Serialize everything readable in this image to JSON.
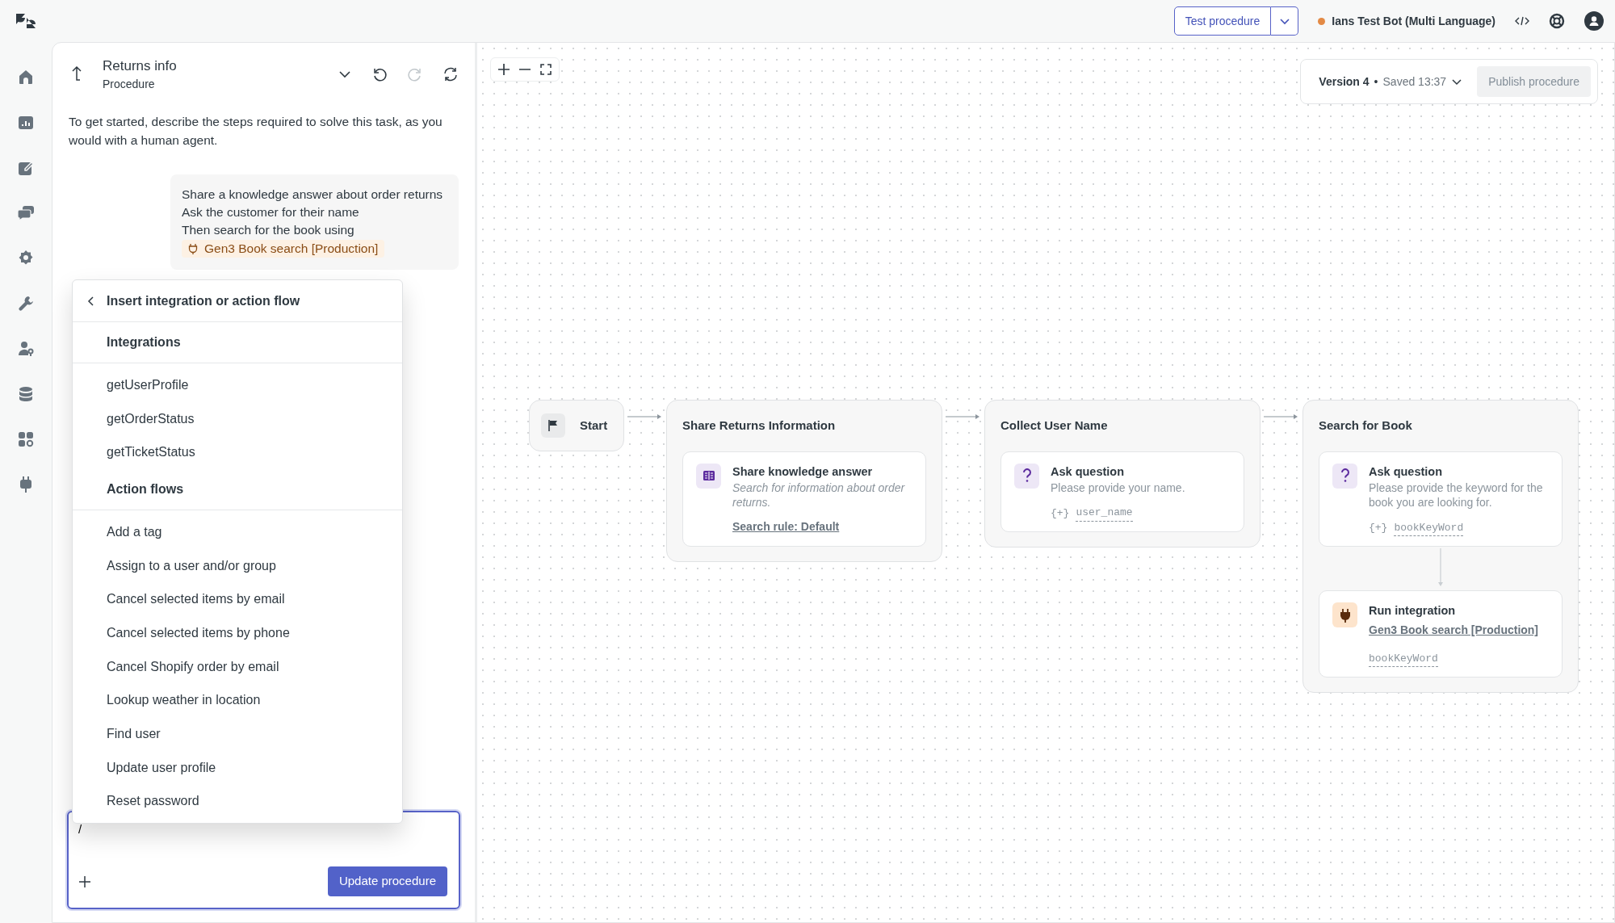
{
  "topbar": {
    "test_button": "Test procedure",
    "bot_name": "Ians Test Bot (Multi Language)"
  },
  "procedure": {
    "title": "Returns info",
    "subtitle": "Procedure",
    "undo": {
      "disabled": false
    },
    "redo": {
      "disabled": true
    }
  },
  "intro": "To get started, describe the steps required to solve this task, as you would with a human agent.",
  "message": {
    "lines": [
      "Share a knowledge answer about order returns",
      "Ask the customer for their name",
      "Then search for the book using"
    ],
    "integration_chip": "Gen3 Book search [Production]"
  },
  "menu": {
    "title": "Insert integration or action flow",
    "sections": [
      {
        "heading": "Integrations",
        "items": [
          "getUserProfile",
          "getOrderStatus",
          "getTicketStatus"
        ]
      },
      {
        "heading": "Action flows",
        "items": [
          "Add a tag",
          "Assign to a user and/or group",
          "Cancel selected items by email",
          "Cancel selected items by phone",
          "Cancel Shopify order by email",
          "Lookup weather in location",
          "Find user",
          "Update user profile",
          "Reset password"
        ]
      }
    ]
  },
  "composer": {
    "value": "/",
    "button": "Update procedure"
  },
  "version": {
    "label": "Version 4",
    "separator": "•",
    "saved": "Saved 13:37",
    "publish": "Publish procedure",
    "publish_disabled": true
  },
  "flow": {
    "nodes": [
      {
        "kind": "start",
        "label": "Start"
      },
      {
        "kind": "step",
        "title": "Share Returns Information",
        "actions": [
          {
            "kind": "knowledge",
            "title": "Share knowledge answer",
            "description": "Search for information about order returns.",
            "link": "Search rule: Default"
          }
        ]
      },
      {
        "kind": "step",
        "title": "Collect User Name",
        "actions": [
          {
            "kind": "question",
            "title": "Ask question",
            "description": "Please provide your name.",
            "variable_prefix": "{+}",
            "variable": "user_name"
          }
        ]
      },
      {
        "kind": "step",
        "title": "Search for Book",
        "actions": [
          {
            "kind": "question",
            "title": "Ask question",
            "description": "Please provide the keyword for the book you are looking for.",
            "variable_prefix": "{+}",
            "variable": "bookKeyWord"
          },
          {
            "kind": "integration",
            "title": "Run integration",
            "link": "Gen3 Book search [Production]",
            "variable": "bookKeyWord"
          }
        ]
      }
    ]
  }
}
